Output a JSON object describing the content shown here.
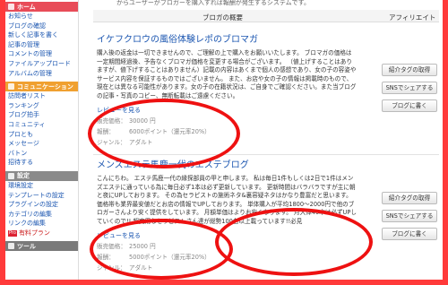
{
  "sidebar": {
    "home": {
      "label": "ホーム",
      "items": [
        "お知らせ",
        "ブログの確認",
        "新しく記事を書く",
        "記事の管理",
        "コメントの管理",
        "ファイルアップロード",
        "アルバムの管理"
      ]
    },
    "community": {
      "label": "コミュニケーション",
      "items": [
        "訪問者リスト",
        "ランキング",
        "ブログ拍手",
        "コミュニティ",
        "プロとも",
        "メッセージ",
        "バトン",
        "招待する"
      ]
    },
    "settings": {
      "label": "設定",
      "items": [
        "環境設定",
        "テンプレートの設定",
        "プラグインの設定",
        "カテゴリの編集",
        "リンクの編集"
      ],
      "pro_badge": "Pro",
      "pro_item": "有料プラン"
    },
    "tools": {
      "label": "ツール"
    }
  },
  "main": {
    "top_note": "からユーザーがブロガーを購入すれば報酬が発生するシステムです。",
    "table_head": {
      "summary": "ブロガの概要",
      "affiliate": "アフィリエイト"
    },
    "entries": [
      {
        "title": "イケフクロウの風俗体験レポのブロマガ",
        "desc": "購入後の返金は一切できませんので、ご理解の上で購入をお願いいたします。 ブロマガの価格は一定期間経過後、予告なくブロマガ価格を変更する場合がございます。 （値上げすることはありますが、値下げすることはありません）記載の内容はあくまで個人の感想であり、女の子の容姿やサービス内容を保証するものではございません。 また、お店や女の子の情報は掲載時のもので、現在とは異なる可能性があります。女の子の在籍状況は、ご自身でご確認ください。また当ブログの記事・写真のコピー、無断転載はご遠慮ください。",
        "review": "レビューを見る",
        "price_label": "販売価格：",
        "price": "30000 円",
        "reward_label": "報酬：",
        "reward": "6000ポイント（還元率20%）",
        "genre_label": "ジャンル：",
        "genre": "アダルト"
      },
      {
        "title": "メンズエステ馬鹿一代のエステブログ",
        "desc": "こんにちわ。 エステ馬鹿一代の縁探部員の甲と申します。 私は毎日1件もしくは2日で1件はメンズエステに通っている為に毎日必ず1本は必ず更新しています。 更新時間はバラバラですが主に朝と夜にUPしております。 その為セラピストの施術ネタ&裏容疑ネタはかなり豊富だと思います。価格帯も業界最安値だとお店の情報でUPしております。 単体購入が平均1800～2000円で他のブロガーさんより安く提供をしています。 月額単価はよりお安くなります。 月大体40本は必ずUPしていくので!! 超実用なセラピストさん達が総勢100名以上載っています!!必見",
        "review": "レビューを見る",
        "price_label": "販売価格：",
        "price": "25000 円",
        "reward_label": "報酬：",
        "reward": "5000ポイント（還元率20%）",
        "genre_label": "ジャンル：",
        "genre": "アダルト"
      }
    ],
    "buttons": {
      "tag": "紹介タグの取得",
      "sns": "SNSでシェアする",
      "blog": "ブログに書く"
    }
  },
  "colors": {
    "annotation": "#ee1111",
    "link": "#1a55b0",
    "home": "#e84c58",
    "community": "#f0a030",
    "settings": "#8a8a8a"
  }
}
